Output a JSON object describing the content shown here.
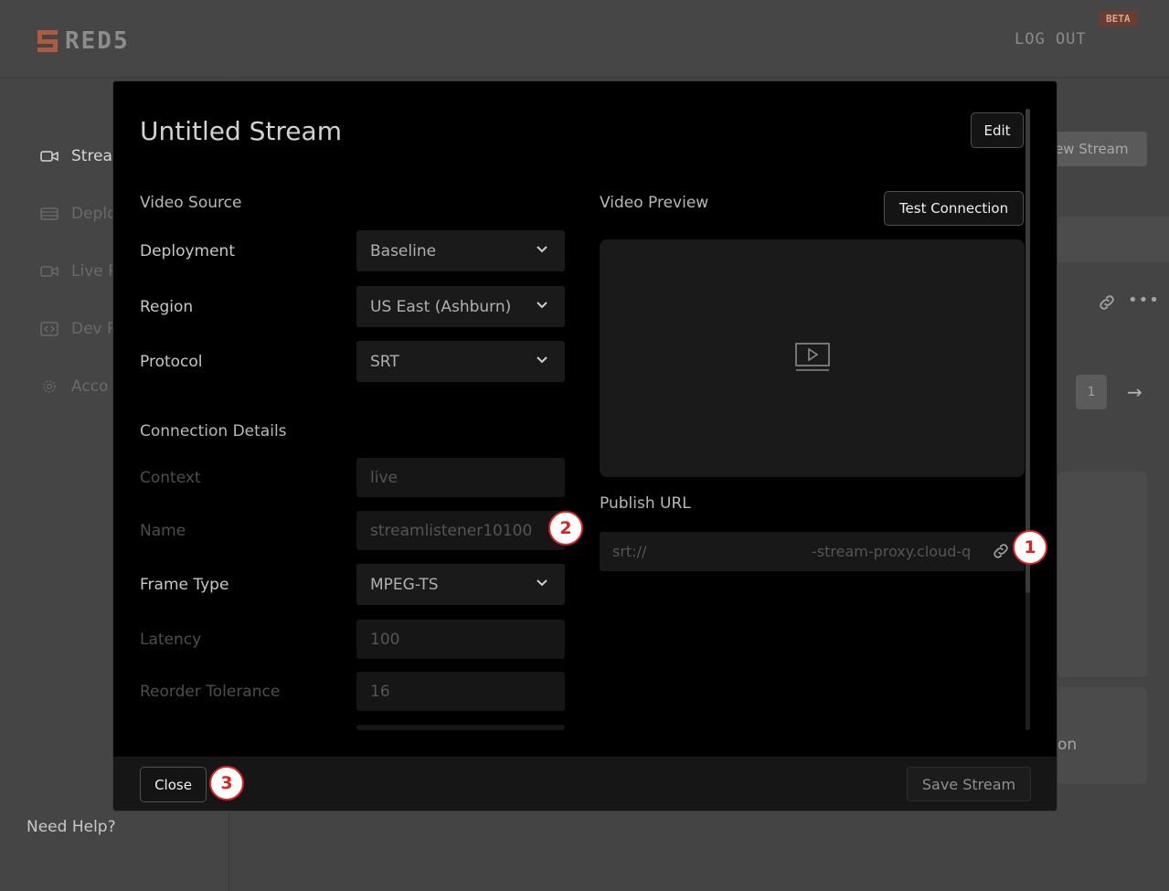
{
  "header": {
    "logo_text": "RED5",
    "logout_label": "LOG OUT",
    "beta_badge": "BETA"
  },
  "sidebar": {
    "items": [
      {
        "label": "Strea",
        "icon": "video-camera-icon"
      },
      {
        "label": "Deplo",
        "icon": "server-icon"
      },
      {
        "label": "Live P",
        "icon": "video-camera-icon"
      },
      {
        "label": "Dev R",
        "icon": "code-icon"
      },
      {
        "label": "Acco",
        "icon": "gear-icon"
      }
    ],
    "need_help": "Need Help?"
  },
  "background": {
    "new_stream_label": "ew Stream",
    "page_number": "1",
    "card_text": "on"
  },
  "modal": {
    "title": "Untitled Stream",
    "edit_label": "Edit",
    "video_source_label": "Video Source",
    "video_preview_label": "Video Preview",
    "test_connection_label": "Test Connection",
    "fields": {
      "deployment": {
        "label": "Deployment",
        "value": "Baseline"
      },
      "region": {
        "label": "Region",
        "value": "US East (Ashburn)"
      },
      "protocol": {
        "label": "Protocol",
        "value": "SRT"
      }
    },
    "connection_details_label": "Connection Details",
    "connection": {
      "context": {
        "label": "Context",
        "value": "live"
      },
      "name": {
        "label": "Name",
        "value": "streamlistener10100"
      },
      "frame_type": {
        "label": "Frame Type",
        "value": "MPEG-TS"
      },
      "latency": {
        "label": "Latency",
        "value": "100"
      },
      "reorder_tolerance": {
        "label": "Reorder Tolerance",
        "value": "16"
      }
    },
    "publish_url_label": "Publish URL",
    "publish_url": {
      "protocol": "srt://",
      "host": "-stream-proxy.cloud-q"
    },
    "close_label": "Close",
    "save_label": "Save Stream"
  },
  "callouts": [
    "1",
    "2",
    "3"
  ],
  "colors": {
    "brand": "#b05a3e",
    "callout": "#dd2222",
    "modal_bg": "#000000"
  }
}
